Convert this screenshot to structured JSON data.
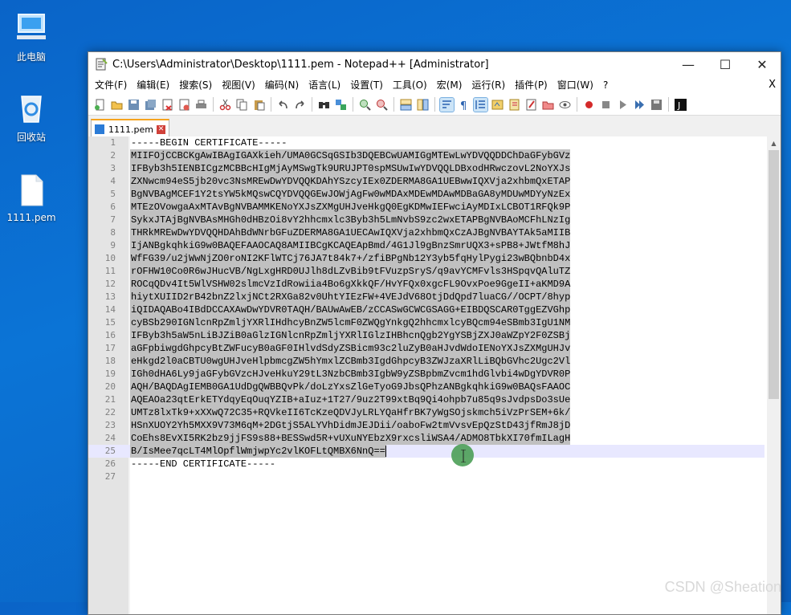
{
  "desktop": {
    "icons": [
      {
        "label": "此电脑"
      },
      {
        "label": "回收站"
      },
      {
        "label": "1111.pem"
      }
    ]
  },
  "window": {
    "title": "C:\\Users\\Administrator\\Desktop\\1111.pem - Notepad++ [Administrator]",
    "controls": {
      "minimize": "—",
      "maximize": "☐",
      "close": "✕"
    }
  },
  "menu": {
    "items": [
      "文件(F)",
      "编辑(E)",
      "搜索(S)",
      "视图(V)",
      "编码(N)",
      "语言(L)",
      "设置(T)",
      "工具(O)",
      "宏(M)",
      "运行(R)",
      "插件(P)",
      "窗口(W)",
      "?"
    ],
    "close_doc": "X"
  },
  "tabs": [
    {
      "label": "1111.pem",
      "active": true
    }
  ],
  "editor": {
    "lines": [
      "-----BEGIN CERTIFICATE-----",
      "MIIFOjCCBCKgAwIBAgIGAXkieh/UMA0GCSqGSIb3DQEBCwUAMIGgMTEwLwYDVQQDDChDaGFybGVz",
      "IFByb3h5IENBICgzMCBBcHIgMjAyMSwgTk9URUJPT0spMSUwIwYDVQQLDBxodHRwczovL2NoYXJs",
      "ZXNwcm94eS5jb20vc3NsMREwDwYDVQQKDAhYSzcyIEx0ZDERMA8GA1UEBwwIQXVja2xhbmQxETAP",
      "BgNVBAgMCEF1Y2tsYW5kMQswCQYDVQQGEwJOWjAgFw0wMDAxMDEwMDAwMDBaGA8yMDUwMDYyNzEx",
      "MTEzOVowgaAxMTAvBgNVBAMMKENoYXJsZXMgUHJveHkgQ0EgKDMwIEFwciAyMDIxLCBOT1RFQk9P",
      "SykxJTAjBgNVBAsMHGh0dHBzOi8vY2hhcmxlc3Byb3h5LmNvbS9zc2wxETAPBgNVBAoMCFhLNzIg",
      "THRkMREwDwYDVQQHDAhBdWNrbGFuZDERMA8GA1UECAwIQXVja2xhbmQxCzAJBgNVBAYTAk5aMIIB",
      "IjANBgkqhkiG9w0BAQEFAAOCAQ8AMIIBCgKCAQEApBmd/4G1Jl9gBnzSmrUQX3+sPB8+JWtfM8hJ",
      "WfFG39/u2jWwNjZO0roNI2KFlWTCj76JA7t84k7+/zfiBPgNb12Y3yb5fqHylPygi23wBQbnbD4x",
      "rOFHW10Co0R6wJHucVB/NgLxgHRD0UJlh8dLZvBib9tFVuzpSryS/q9avYCMFvls3HSpqvQAluTZ",
      "ROCqQDv4It5WlVSHW02slmcVzIdRowiia4Bo6gXkkQF/HvYFQx0xgcFL9OvxPoe9GgeII+aKMD9A",
      "hiytXUIID2rB42bnZ2lxjNCt2RXGa82v0UhtYIEzFW+4VEJdV68OtjDdQpd7luaCG//OCPT/8hyp",
      "iQIDAQABo4IBdDCCAXAwDwYDVR0TAQH/BAUwAwEB/zCCASwGCWCGSAGG+EIBDQSCAR0TggEZVGhp",
      "cyBSb290IGNlcnRpZmljYXRlIHdhcyBnZW5lcmF0ZWQgYnkgQ2hhcmxlcyBQcm94eSBmb3IgU1NM",
      "IFByb3h5aW5nLiBJZiB0aGlzIGNlcnRpZmljYXRlIGlzIHBhcnQgb2YgYSBjZXJ0aWZpY2F0ZSBj",
      "aGFpbiwgdGhpcyBtZWFucyB0aGF0IHlvdSdyZSBicm93c2luZyB0aHJvdWdoIENoYXJsZXMgUHJv",
      "eHkgd2l0aCBTU0wgUHJveHlpbmcgZW5hYmxlZCBmb3IgdGhpcyB3ZWJzaXRlLiBQbGVhc2Ugc2Vl",
      "IGh0dHA6Ly9jaGFybGVzcHJveHkuY29tL3NzbCBmb3IgbW9yZSBpbmZvcm1hdGlvbi4wDgYDVR0P",
      "AQH/BAQDAgIEMB0GA1UdDgQWBBQvPk/doLzYxsZlGeTyoG9JbsQPhzANBgkqhkiG9w0BAQsFAAOC",
      "AQEAOa23qtErkETYdqyEqOuqYZIB+aIuz+1T27/9uz2T99xtBq9Qi4ohpb7u85q9sJvdpsDo3sUe",
      "UMTz8lxTk9+xXXwQ72C35+RQVkeII6TcKzeQDVJyLRLYQaHfrBK7yWgSOjskmch5iVzPrSEM+6k/",
      "HSnXUOY2Yh5MXX9V73M6qM+2DGtjS5ALYVhDidmJEJDii/oaboFw2tmVvsvEpQzStD43jfRmJ8jD",
      "CoEhs8EvXI5RK2bz9jjFS9s88+BESSwd5R+vUXuNYEbzX9rxcsliWSA4/ADMO8TbkXI70fmILagH",
      "B/IsMee7qcLT4MlOpflWmjwpYc2vlKOFLtQMBX6NnQ==",
      "-----END CERTIFICATE-----",
      ""
    ]
  },
  "watermark": "CSDN @Sheation",
  "colors": {
    "desktop_bg": "#0b74d6",
    "tab_accent": "#f6a41f",
    "selection": "#c0c0c0",
    "current_line": "#e8e8ff"
  }
}
